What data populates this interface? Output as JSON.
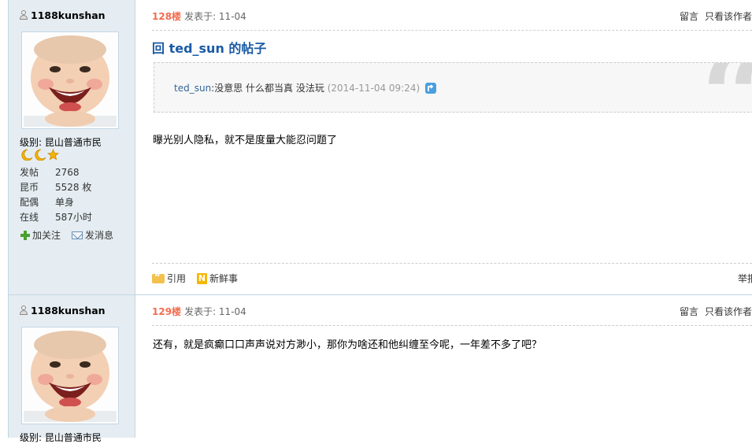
{
  "posts": [
    {
      "author": "1188kunshan",
      "level": "级别: 昆山普通市民",
      "stats": [
        {
          "label": "发帖",
          "value": "2768"
        },
        {
          "label": "昆币",
          "value": "5528 枚"
        },
        {
          "label": "配偶",
          "value": "单身"
        },
        {
          "label": "在线",
          "value": "587小时"
        }
      ],
      "follow_label": "加关注",
      "message_label": "发消息",
      "floor": "128楼",
      "posted": "发表于: 11-04",
      "leave_message": "留言",
      "only_author": "只看该作者",
      "reply_title": "回 ted_sun 的帖子",
      "quote_author": "ted_sun",
      "quote_body": ":没意思   什么都当真  没法玩",
      "quote_time": "(2014-11-04 09:24)",
      "body": "曝光别人隐私，就不是度量大能忍问题了",
      "cite_label": "引用",
      "fresh_label": "新鲜事",
      "report_label": "举报"
    },
    {
      "author": "1188kunshan",
      "level": "级别: 昆山普通市民",
      "floor": "129楼",
      "posted": "发表于: 11-04",
      "leave_message": "留言",
      "only_author": "只看该作者",
      "body": "还有，就是疯癫口口声声说对方渺小，那你为啥还和他纠缠至今呢，一年差不多了吧？"
    }
  ],
  "colors": {
    "sidebar_bg": "#e5edf2",
    "floor": "#f26c4f",
    "title": "#1a5aa5"
  }
}
